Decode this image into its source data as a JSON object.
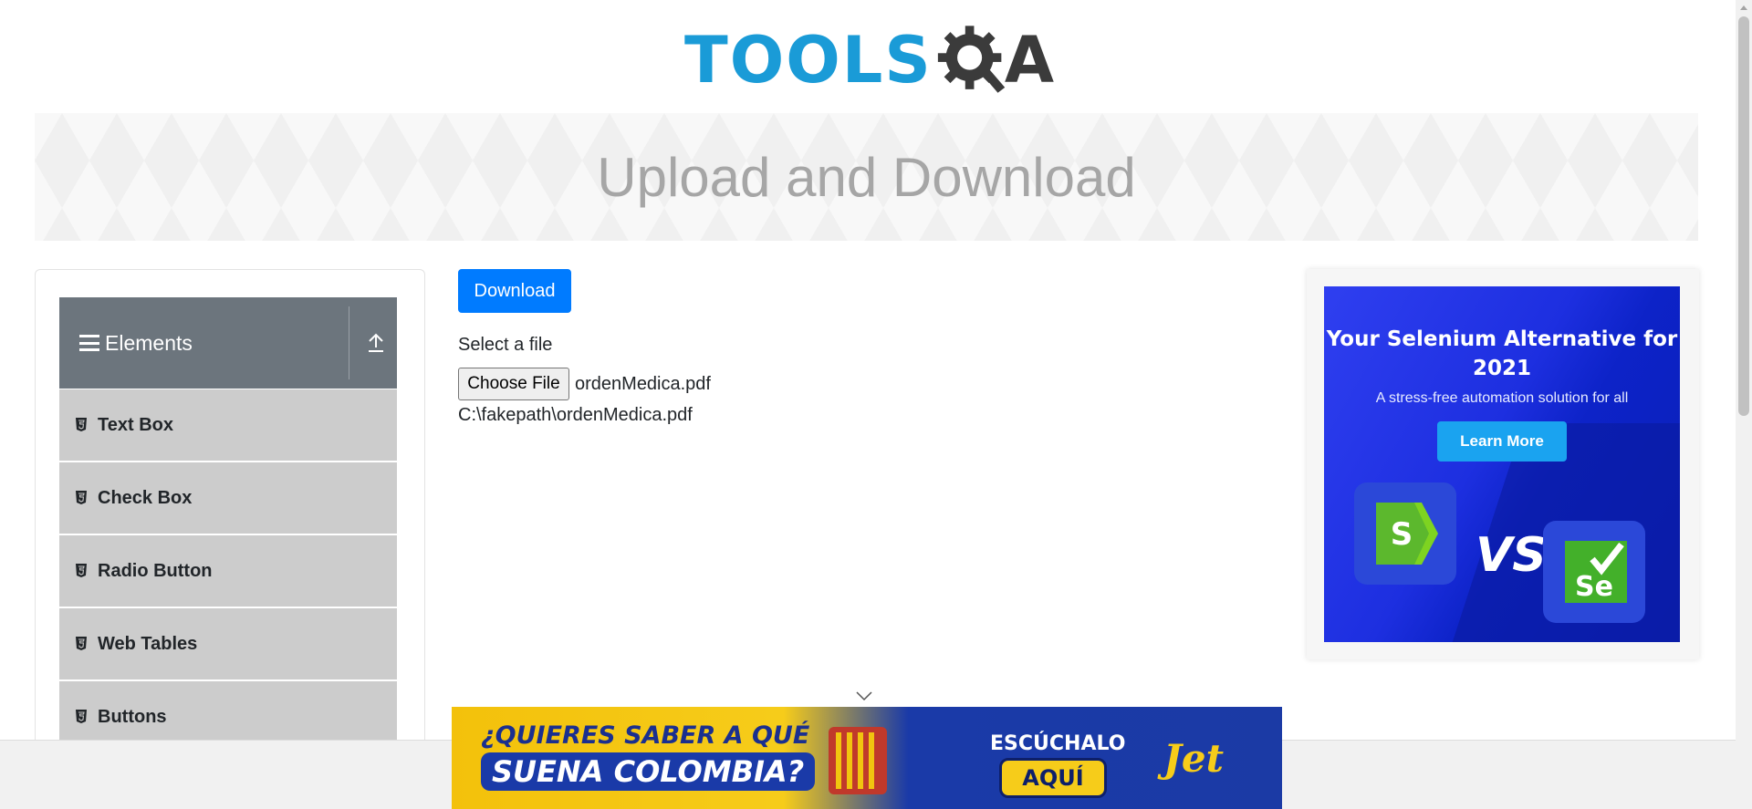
{
  "header": {
    "logo_word": "TOOLS",
    "logo_suffix": "A",
    "logo_colors": {
      "tools": "#1a9bd7",
      "qa": "#3b3b3b"
    }
  },
  "banner": {
    "title": "Upload and Download"
  },
  "sidebar": {
    "group_title": "Elements",
    "items": [
      {
        "label": "Text Box"
      },
      {
        "label": "Check Box"
      },
      {
        "label": "Radio Button"
      },
      {
        "label": "Web Tables"
      },
      {
        "label": "Buttons"
      }
    ]
  },
  "main": {
    "download_label": "Download",
    "select_label": "Select a file",
    "choose_file_label": "Choose File",
    "selected_file": "ordenMedica.pdf",
    "uploaded_path": "C:\\fakepath\\ordenMedica.pdf"
  },
  "right_ad": {
    "title": "Your Selenium Alternative for 2021",
    "subtitle": "A stress-free automation solution for all",
    "button": "Learn More",
    "vs": "VS"
  },
  "bottom_ad": {
    "line1": "¿QUIERES SABER A QUÉ",
    "line2": "SUENA COLOMBIA?",
    "cta_top": "ESCÚCHALO",
    "cta": "AQUÍ",
    "brand": "Jet"
  },
  "colors": {
    "primary": "#007bff",
    "sidebar_header": "#6c757d",
    "sidebar_item": "#cccccc"
  }
}
